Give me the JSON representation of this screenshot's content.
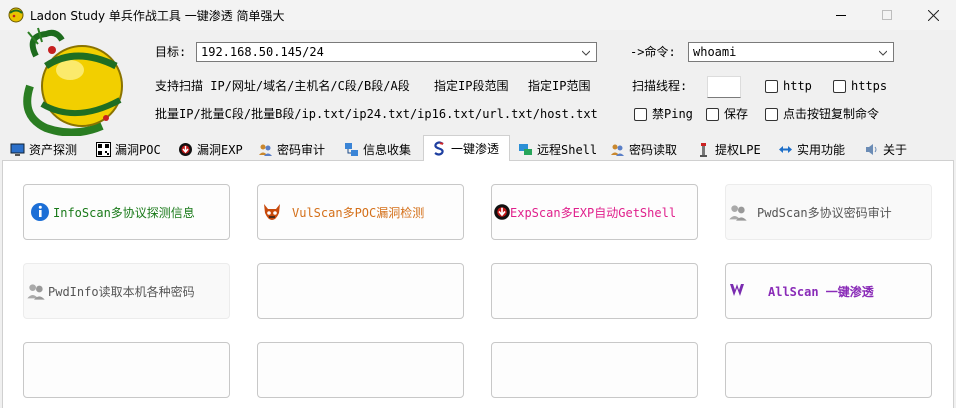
{
  "window": {
    "title": "Ladon Study 单兵作战工具 一键渗透 简单强大",
    "icons": {
      "app": "dragon-ball-icon",
      "minimize": "minimize-icon",
      "maximize": "maximize-icon",
      "close": "close-icon"
    }
  },
  "form": {
    "target_label": "目标:",
    "target_value": "192.168.50.145/24",
    "command_label": "->命令:",
    "command_value": "whoami",
    "scan_support_label": "支持扫描 IP/网址/域名/主机名/C段/B段/A段",
    "ip_range_label": "指定IP段范围",
    "ip_range2_label": "指定IP范围",
    "batch_label": "批量IP/批量C段/批量B段/ip.txt/ip24.txt/ip16.txt/url.txt/host.txt",
    "threads_label": "扫描线程:",
    "threads_value": "",
    "http_label": "http",
    "https_label": "https",
    "noping_label": "禁Ping",
    "save_label": "保存",
    "copycmd_label": "点击按钮复制命令",
    "checks": {
      "http": false,
      "https": false,
      "noping": false,
      "save": false,
      "copycmd": false
    }
  },
  "tabs": [
    {
      "label": "资产探测",
      "icon": "monitor-icon"
    },
    {
      "label": "漏洞POC",
      "icon": "qr-code-icon"
    },
    {
      "label": "漏洞EXP",
      "icon": "exploit-icon"
    },
    {
      "label": "密码审计",
      "icon": "users-icon"
    },
    {
      "label": "信息收集",
      "icon": "network-icon"
    },
    {
      "label": "一键渗透",
      "icon": "s-logo-icon",
      "active": true
    },
    {
      "label": "远程Shell",
      "icon": "remote-icon"
    },
    {
      "label": "密码读取",
      "icon": "users-key-icon"
    },
    {
      "label": "提权LPE",
      "icon": "tower-icon"
    },
    {
      "label": "实用功能",
      "icon": "arrows-icon"
    },
    {
      "label": "关于",
      "icon": "speaker-icon"
    }
  ],
  "buttons": [
    {
      "label": "InfoScan多协议探测信息",
      "color": "#1a7a1a",
      "icon": "info-icon"
    },
    {
      "label": "VulScan多POC漏洞检测",
      "color": "#d4701a",
      "icon": "devil-mask-icon"
    },
    {
      "label": "ExpScan多EXP自动GetShell",
      "color": "#e0208c",
      "icon": "exploit-icon"
    },
    {
      "label": "PwdScan多协议密码审计",
      "color": "#555555",
      "icon": "users-icon"
    },
    {
      "label": "PwdInfo读取本机各种密码",
      "color": "#555555",
      "icon": "users-icon"
    },
    {
      "label": "",
      "color": "#000000",
      "icon": ""
    },
    {
      "label": "",
      "color": "#000000",
      "icon": ""
    },
    {
      "label": "AllScan 一键渗透",
      "color": "#8a2cb8",
      "icon": "vs-logo-icon"
    },
    {
      "label": "",
      "color": "#000000",
      "icon": ""
    },
    {
      "label": "",
      "color": "#000000",
      "icon": ""
    },
    {
      "label": "",
      "color": "#000000",
      "icon": ""
    },
    {
      "label": "",
      "color": "#000000",
      "icon": ""
    }
  ]
}
